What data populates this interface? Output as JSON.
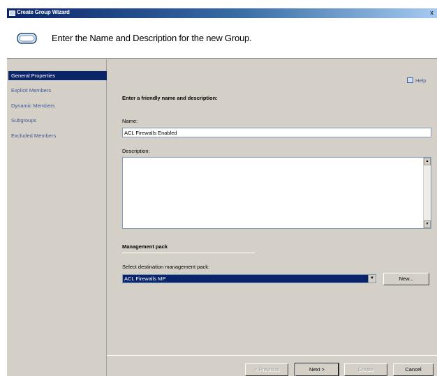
{
  "window": {
    "title": "Create Group Wizard",
    "close_glyph": "x"
  },
  "header": {
    "title": "Enter the Name and Description for the new Group."
  },
  "sidebar": {
    "items": [
      {
        "label": "General Properties",
        "active": true
      },
      {
        "label": "Explicit Members",
        "active": false
      },
      {
        "label": "Dynamic Members",
        "active": false
      },
      {
        "label": "Subgroups",
        "active": false
      },
      {
        "label": "Excluded Members",
        "active": false
      }
    ]
  },
  "main": {
    "help_label": "Help",
    "section_title": "Enter a friendly name and description:",
    "name_label": "Name:",
    "name_value": "ACL Firewalls Enabled",
    "description_label": "Description:",
    "description_value": "",
    "mp_section_title": "Management pack",
    "mp_select_label": "Select destination management pack:",
    "mp_selected": "ACL Firewalls MP",
    "new_button": "New..."
  },
  "footer": {
    "previous": "< Previous",
    "next": "Next >",
    "create": "Create",
    "cancel": "Cancel"
  }
}
